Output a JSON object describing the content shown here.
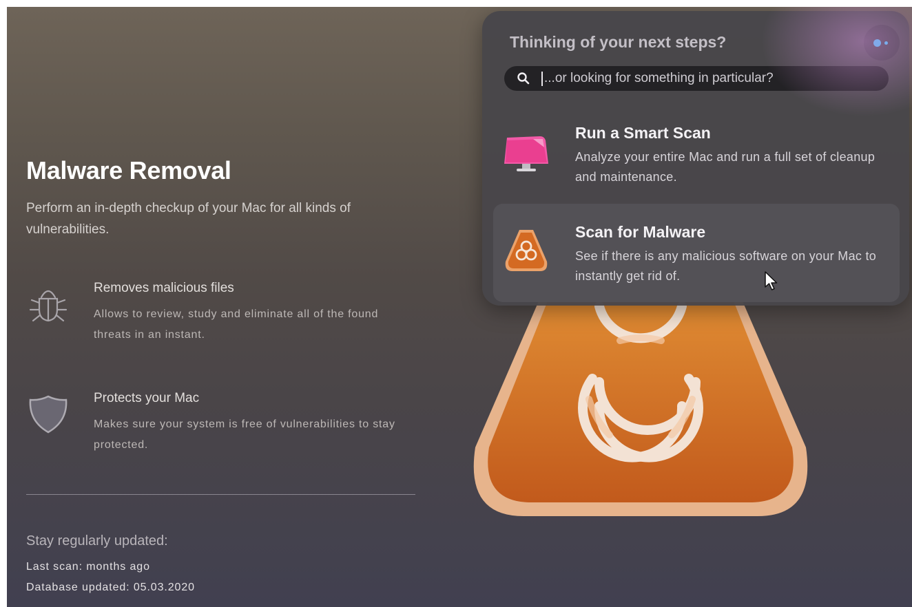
{
  "main": {
    "title": "Malware Removal",
    "description": "Perform an in-depth checkup of your Mac for all kinds of vulnerabilities.",
    "features": [
      {
        "icon": "bug-icon",
        "title": "Removes malicious files",
        "description": "Allows to review, study and eliminate all of the found threats in an instant."
      },
      {
        "icon": "shield-icon",
        "title": "Protects your Mac",
        "description": "Makes sure your system is free of vulnerabilities to stay protected."
      }
    ],
    "update": {
      "heading": "Stay regularly updated:",
      "last_scan": "Last scan: months ago",
      "database_updated": "Database updated: 05.03.2020"
    },
    "hero_icon": "biohazard-icon"
  },
  "popup": {
    "title": "Thinking of your next steps?",
    "assistant_icon": "assistant-icon",
    "search": {
      "placeholder": "...or looking for something in particular?",
      "icon": "search-icon"
    },
    "items": [
      {
        "icon": "smart-scan-icon",
        "title": "Run a Smart Scan",
        "description": "Analyze your entire Mac and run a full set of cleanup and maintenance."
      },
      {
        "icon": "malware-scan-icon",
        "title": "Scan for Malware",
        "description": "See if there is any malicious software on your Mac to instantly get rid of."
      }
    ]
  },
  "colors": {
    "accent_blue": "#3fc6ff",
    "malware_orange": "#d9822f",
    "smart_scan_pink": "#f04aa0"
  }
}
